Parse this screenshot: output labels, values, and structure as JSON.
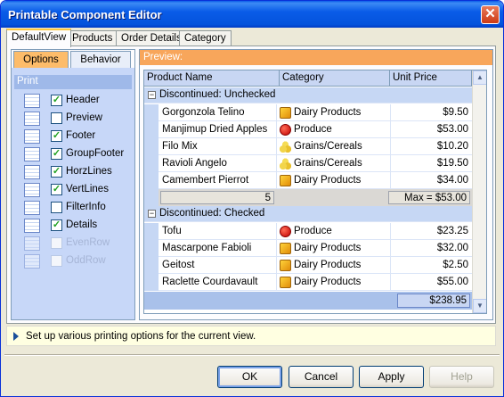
{
  "window": {
    "title": "Printable Component Editor",
    "close_glyph": "✕"
  },
  "top_tabs": [
    "DefaultView",
    "Products",
    "Order Details",
    "Category"
  ],
  "options_panel": {
    "tabs": [
      "Options",
      "Behavior"
    ],
    "section": "Print",
    "items": [
      {
        "label": "Header",
        "checked": true,
        "enabled": true
      },
      {
        "label": "Preview",
        "checked": false,
        "enabled": true
      },
      {
        "label": "Footer",
        "checked": true,
        "enabled": true
      },
      {
        "label": "GroupFooter",
        "checked": true,
        "enabled": true
      },
      {
        "label": "HorzLines",
        "checked": true,
        "enabled": true
      },
      {
        "label": "VertLines",
        "checked": true,
        "enabled": true
      },
      {
        "label": "FilterInfo",
        "checked": false,
        "enabled": true
      },
      {
        "label": "Details",
        "checked": true,
        "enabled": true
      },
      {
        "label": "EvenRow",
        "checked": false,
        "enabled": false
      },
      {
        "label": "OddRow",
        "checked": false,
        "enabled": false
      }
    ]
  },
  "preview": {
    "label": "Preview:",
    "columns": [
      "Product Name",
      "Category",
      "Unit Price"
    ],
    "groups": [
      {
        "title": "Discontinued: Unchecked",
        "expander": "−",
        "rows": [
          {
            "name": "Gorgonzola Telino",
            "category": "Dairy Products",
            "icon": "dairy-icon",
            "price": "$9.50"
          },
          {
            "name": "Manjimup Dried Apples",
            "category": "Produce",
            "icon": "produce-icon",
            "price": "$53.00"
          },
          {
            "name": "Filo Mix",
            "category": "Grains/Cereals",
            "icon": "grains-icon",
            "price": "$10.20"
          },
          {
            "name": "Ravioli Angelo",
            "category": "Grains/Cereals",
            "icon": "grains-icon",
            "price": "$19.50"
          },
          {
            "name": "Camembert Pierrot",
            "category": "Dairy Products",
            "icon": "dairy-icon",
            "price": "$34.00"
          }
        ],
        "footer": {
          "count": "5",
          "max": "Max = $53.00"
        }
      },
      {
        "title": "Discontinued: Checked",
        "expander": "−",
        "rows": [
          {
            "name": "Tofu",
            "category": "Produce",
            "icon": "produce-icon",
            "price": "$23.25"
          },
          {
            "name": "Mascarpone Fabioli",
            "category": "Dairy Products",
            "icon": "dairy-icon",
            "price": "$32.00"
          },
          {
            "name": "Geitost",
            "category": "Dairy Products",
            "icon": "dairy-icon",
            "price": "$2.50"
          },
          {
            "name": "Raclette Courdavault",
            "category": "Dairy Products",
            "icon": "dairy-icon",
            "price": "$55.00"
          }
        ]
      }
    ],
    "total": "$238.95",
    "scroll_up": "▲",
    "scroll_down": "▼"
  },
  "hint": "Set up various printing options for the current view.",
  "buttons": {
    "ok": "OK",
    "cancel": "Cancel",
    "apply": "Apply",
    "help": "Help"
  },
  "colors": {
    "title_bar": "#0a5ce8",
    "preview_bar": "#f8a65b",
    "options_tab": "#fdbc6a",
    "group_row": "#c6d7f4"
  }
}
